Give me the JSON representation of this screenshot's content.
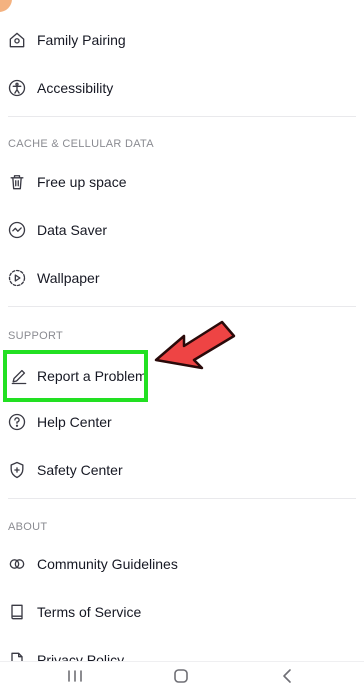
{
  "colors": {
    "text": "#161823",
    "section_header": "#8a8b91",
    "highlight_box": "#22e022",
    "arrow": "#ee4444"
  },
  "items_top": [
    {
      "label": "Family Pairing",
      "icon": "family-pairing-icon"
    },
    {
      "label": "Accessibility",
      "icon": "accessibility-icon"
    }
  ],
  "sections": [
    {
      "header": "CACHE & CELLULAR DATA",
      "items": [
        {
          "label": "Free up space",
          "icon": "trash-icon"
        },
        {
          "label": "Data Saver",
          "icon": "data-saver-icon"
        },
        {
          "label": "Wallpaper",
          "icon": "wallpaper-icon"
        }
      ]
    },
    {
      "header": "SUPPORT",
      "items": [
        {
          "label": "Report a Problem",
          "icon": "pencil-icon"
        },
        {
          "label": "Help Center",
          "icon": "help-icon"
        },
        {
          "label": "Safety Center",
          "icon": "shield-icon"
        }
      ]
    },
    {
      "header": "ABOUT",
      "items": [
        {
          "label": "Community Guidelines",
          "icon": "community-guidelines-icon"
        },
        {
          "label": "Terms of Service",
          "icon": "book-icon"
        },
        {
          "label": "Privacy Policy",
          "icon": "document-icon"
        }
      ]
    }
  ],
  "navbar": {
    "recents": "recents-icon",
    "home": "home-icon",
    "back": "back-icon"
  }
}
